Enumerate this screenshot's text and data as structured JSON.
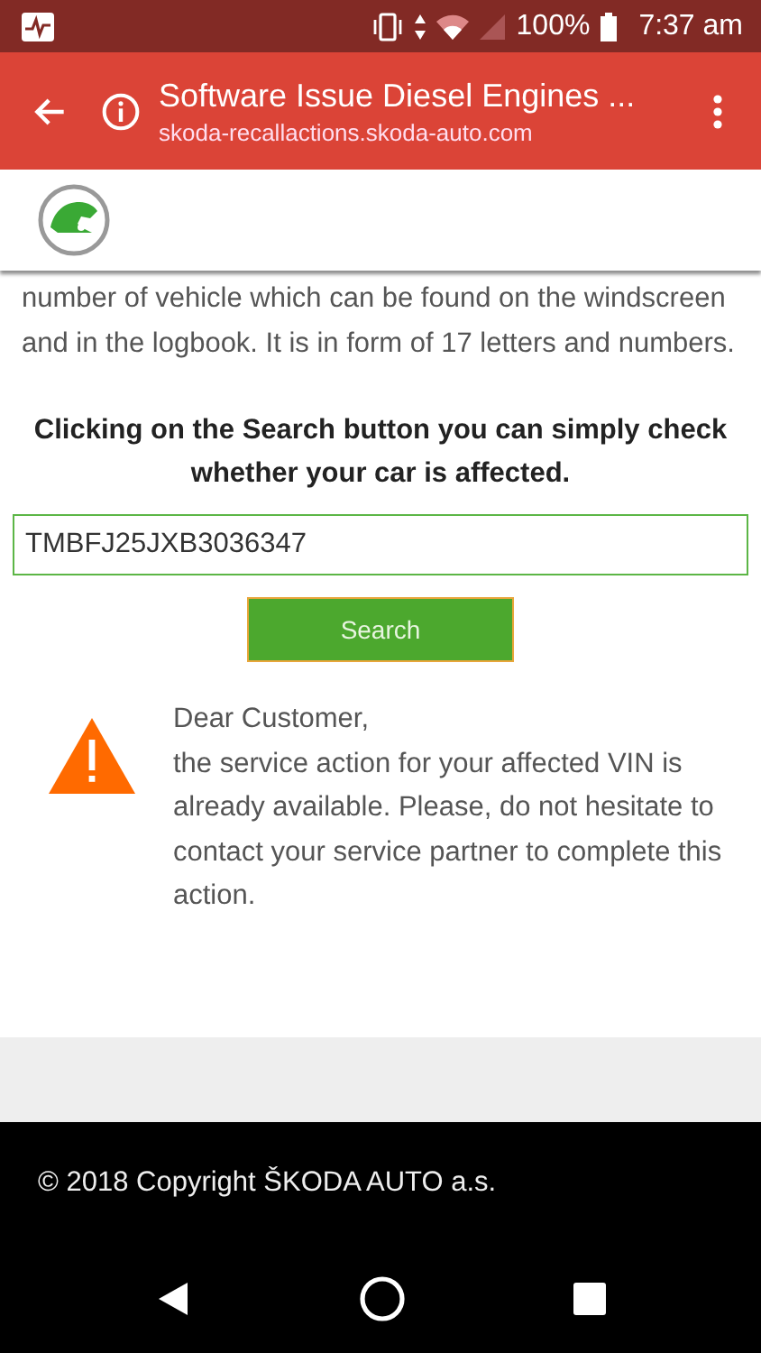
{
  "status_bar": {
    "battery": "100%",
    "time": "7:37 am"
  },
  "browser_toolbar": {
    "title": "Software Issue Diesel Engines ...",
    "url": "skoda-recallactions.skoda-auto.com"
  },
  "intro_text": "number of vehicle which can be found on the windscreen and in the logbook. It is in form of 17 letters and numbers.",
  "instruction": "Clicking on the Search button you can simply check whether your car is affected.",
  "vin_field": {
    "value": "TMBFJ25JXB3036347"
  },
  "search_button": "Search",
  "notice": {
    "greeting": "Dear Customer,",
    "message": "the service action for your affected VIN is already available. Please, do not hesitate to contact your service partner to complete this action."
  },
  "footer": {
    "copyright": "© 2018 Copyright ŠKODA AUTO a.s."
  }
}
